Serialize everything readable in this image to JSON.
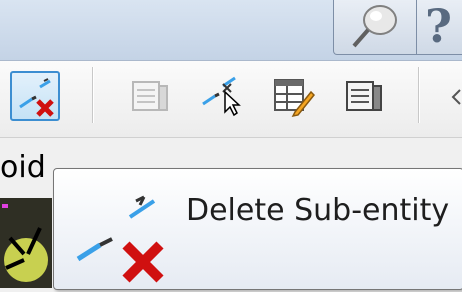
{
  "toolbar": {
    "buttons": [
      {
        "name": "delete-sub-entity",
        "icon": "delete-sub-entity-icon",
        "active": true
      },
      {
        "name": "table-disabled",
        "icon": "table-icon"
      },
      {
        "name": "select-sub-entity",
        "icon": "sub-entity-cursor-icon"
      },
      {
        "name": "edit-table",
        "icon": "table-edit-icon"
      },
      {
        "name": "table",
        "icon": "table-icon"
      }
    ]
  },
  "tab": {
    "label": "oid"
  },
  "tooltip": {
    "text": "Delete Sub-entity"
  },
  "colors": {
    "active_border": "#3c8ed1",
    "delete_x": "#d01010"
  }
}
